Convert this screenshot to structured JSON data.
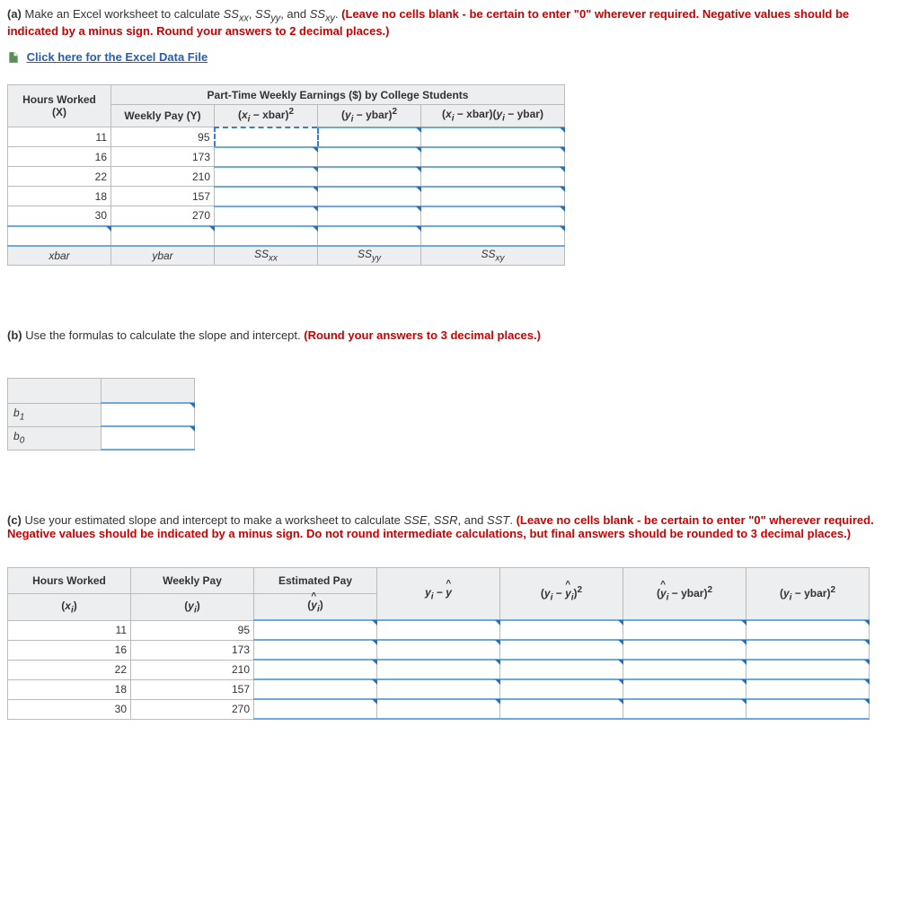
{
  "partA": {
    "label": "(a)",
    "text": "Make an Excel worksheet to calculate ",
    "ss_list": [
      "SS",
      "xx",
      ", SS",
      "yy",
      ", and SS",
      "xy",
      ". "
    ],
    "warn": "(Leave no cells blank - be certain to enter \"0\" wherever required. Negative values should be indicated by a minus sign. Round your answers to 2 decimal places.)",
    "link": "Click here for the Excel Data File"
  },
  "tableA": {
    "title": "Part-Time Weekly Earnings ($) by College Students",
    "header": {
      "x": "Hours Worked (X)",
      "y": "Weekly Pay (Y)"
    },
    "col_xx": "(xᵢ − xbar)²",
    "col_yy": "(yᵢ − ybar)²",
    "col_xy": "(xᵢ − xbar)(yᵢ − ybar)",
    "rows": [
      {
        "x": "11",
        "y": "95"
      },
      {
        "x": "16",
        "y": "173"
      },
      {
        "x": "22",
        "y": "210"
      },
      {
        "x": "18",
        "y": "157"
      },
      {
        "x": "30",
        "y": "270"
      }
    ],
    "footer": {
      "xbar": "xbar",
      "ybar": "ybar",
      "ssxx": "SSxx",
      "ssyy": "SSyy",
      "ssxy": "SSxy"
    }
  },
  "partB": {
    "label": "(b)",
    "text": "Use the formulas to calculate the slope and intercept. ",
    "warn": "(Round your answers to 3 decimal places.)"
  },
  "tableB": {
    "rows": [
      "b1",
      "b0"
    ]
  },
  "partC": {
    "label": "(c)",
    "text": "Use your estimated slope and intercept to make a worksheet to calculate SSE, SSR, and SST. ",
    "warn": "(Leave no cells blank - be certain to enter \"0\" wherever required. Negative values should be indicated by a minus sign. Do not round intermediate calculations, but final answers should be rounded to 3 decimal places.)"
  },
  "tableC": {
    "header1": [
      "Hours Worked",
      "Weekly Pay",
      "Estimated Pay",
      "",
      "",
      "",
      ""
    ],
    "header2_plain": [
      "(xᵢ)",
      "(yᵢ)",
      "(ŷᵢ)",
      "yᵢ − ŷ",
      "(yᵢ − ŷᵢ)²",
      "(ŷᵢ − ybar)²",
      "(yᵢ − ybar)²"
    ],
    "rows": [
      {
        "x": "11",
        "y": "95"
      },
      {
        "x": "16",
        "y": "173"
      },
      {
        "x": "22",
        "y": "210"
      },
      {
        "x": "18",
        "y": "157"
      },
      {
        "x": "30",
        "y": "270"
      }
    ]
  }
}
